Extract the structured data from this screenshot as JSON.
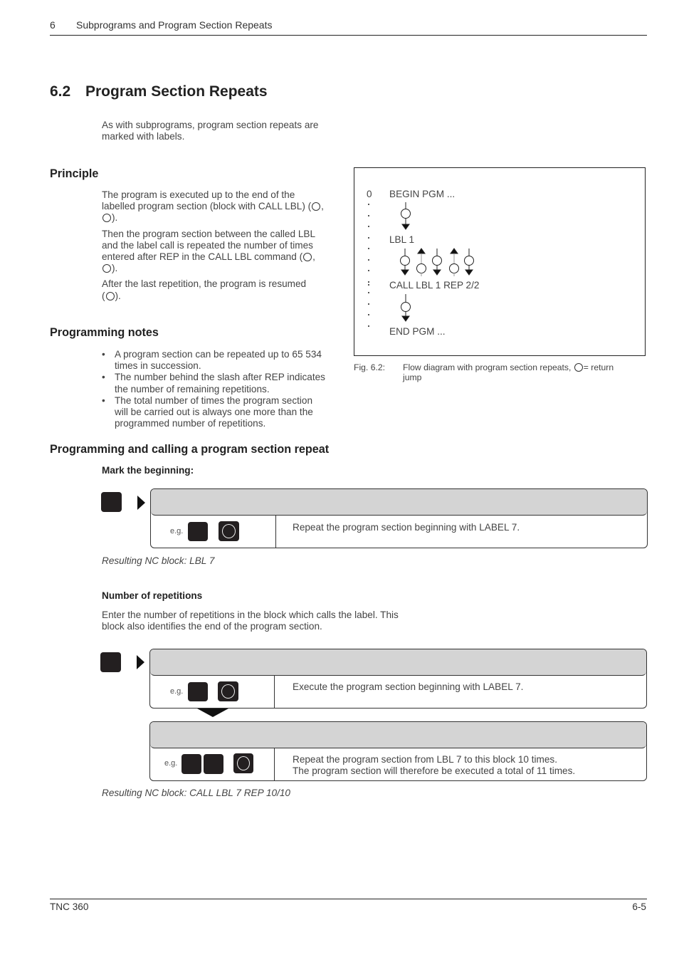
{
  "header": {
    "chapter_number": "6",
    "chapter_title": "Subprograms and Program Section Repeats"
  },
  "section": {
    "number": "6.2",
    "title": "Program Section Repeats",
    "intro": [
      "As with subprograms, program section repeats are",
      "marked with labels."
    ]
  },
  "principle": {
    "heading": "Principle",
    "p1": [
      "The program is executed up to the end of the",
      "labelled program section (block with CALL LBL) ("
    ],
    "p2": [
      "Then the program section between the called LBL",
      "and the label call is repeated the number of times",
      "entered after REP in the CALL LBL command ("
    ],
    "p3": [
      "After the last repetition, the program is resumed"
    ]
  },
  "notes": {
    "heading": "Programming notes",
    "items": [
      [
        "A program section can be repeated up to 65 534",
        "times in succession."
      ],
      [
        "The number behind the slash after REP indicates",
        "the number of remaining repetitions."
      ],
      [
        "The total number of times the program section",
        "will be carried out is always one more than the",
        "programmed number of repetitions."
      ]
    ]
  },
  "figure": {
    "line_number": "0",
    "begin": "BEGIN PGM ...",
    "lbl": "LBL 1",
    "call": "CALL LBL 1 REP 2/2",
    "end": "END PGM ...",
    "caption_label": "Fig. 6.2:",
    "caption_text_a": "Flow diagram with program section repeats,",
    "caption_text_b": "= return",
    "caption_text_c": "jump"
  },
  "calling": {
    "heading": "Programming and calling a program section repeat",
    "mark_heading": "Mark the beginning:",
    "mark_dialog": {
      "eg": "e.g.",
      "text": "Repeat the program section beginning with LABEL 7."
    },
    "mark_result": "Resulting NC block: LBL 7",
    "reps_heading": "Number of repetitions",
    "reps_intro": [
      "Enter the number of repetitions in the block which calls the label. This",
      "block also identifies the end of the program section."
    ],
    "call_dialog": {
      "eg": "e.g.",
      "text": "Execute the program section beginning with LABEL 7."
    },
    "rep_dialog": {
      "eg": "e.g.",
      "text": [
        "Repeat the program section from LBL 7 to this block 10 times.",
        "The program section will therefore be executed a total of 11 times."
      ]
    },
    "call_result": "Resulting NC block: CALL LBL 7 REP 10/10"
  },
  "footer": {
    "product": "TNC 360",
    "page": "6-5"
  }
}
